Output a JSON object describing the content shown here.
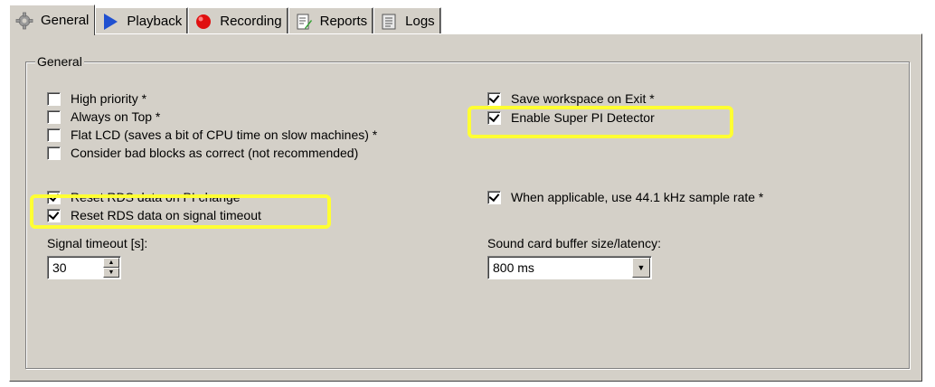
{
  "tabs": [
    {
      "label": "General",
      "icon": "gear-icon",
      "active": true
    },
    {
      "label": "Playback",
      "icon": "play-icon",
      "active": false
    },
    {
      "label": "Recording",
      "icon": "record-icon",
      "active": false
    },
    {
      "label": "Reports",
      "icon": "report-icon",
      "active": false
    },
    {
      "label": "Logs",
      "icon": "log-icon",
      "active": false
    }
  ],
  "group": {
    "title": "General"
  },
  "options": {
    "high_priority": {
      "label": "High priority *",
      "checked": false
    },
    "always_on_top": {
      "label": "Always on Top *",
      "checked": false
    },
    "flat_lcd": {
      "label": "Flat LCD (saves a bit of CPU time on slow machines) *",
      "checked": false
    },
    "bad_blocks": {
      "label": "Consider bad blocks as correct (not recommended)",
      "checked": false
    },
    "save_workspace": {
      "label": "Save workspace on Exit *",
      "checked": true
    },
    "super_pi": {
      "label": "Enable Super PI Detector",
      "checked": true
    },
    "reset_pi": {
      "label": "Reset RDS data on PI change",
      "checked": true
    },
    "reset_timeout": {
      "label": "Reset RDS data on signal timeout",
      "checked": true
    },
    "sample_rate": {
      "label": "When applicable, use 44.1 kHz sample rate *",
      "checked": true
    }
  },
  "signal_timeout": {
    "label": "Signal timeout [s]:",
    "value": "30"
  },
  "sound_buffer": {
    "label": "Sound card buffer size/latency:",
    "value": "800 ms"
  },
  "colors": {
    "panel": "#d4d0c8",
    "highlight": "#ffff33",
    "record": "#e01010",
    "play": "#2050d0"
  }
}
